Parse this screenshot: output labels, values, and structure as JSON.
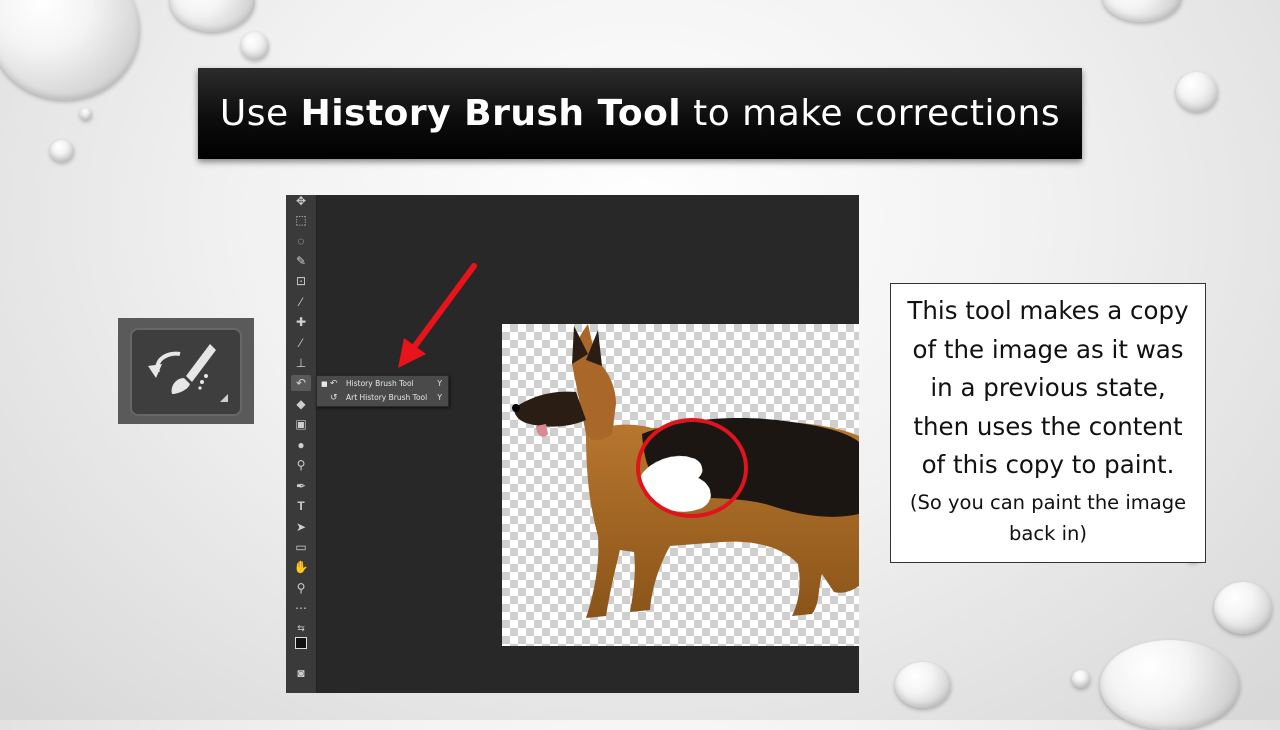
{
  "slide": {
    "title_pre": "Use ",
    "title_bold": "History Brush Tool",
    "title_post": " to make corrections"
  },
  "tool_icon": {
    "name": "history-brush-icon"
  },
  "photoshop": {
    "flyout": {
      "items": [
        {
          "label": "History Brush Tool",
          "shortcut": "Y",
          "selected": true,
          "icon": "history-brush-icon"
        },
        {
          "label": "Art History Brush Tool",
          "shortcut": "Y",
          "selected": false,
          "icon": "art-history-brush-icon"
        }
      ]
    },
    "canvas_subject": "german-shepherd-dog"
  },
  "description": {
    "main": "This tool makes a copy of the image as it was in a previous state, then uses the content of this copy to paint.",
    "note": "(So you can paint the image back in)"
  },
  "colors": {
    "title_bar": "#0d0d0d",
    "arrow": "#e8131b",
    "circle": "#e0141c",
    "ps_background": "#282828",
    "ps_toolbar": "#3a3a3a"
  }
}
